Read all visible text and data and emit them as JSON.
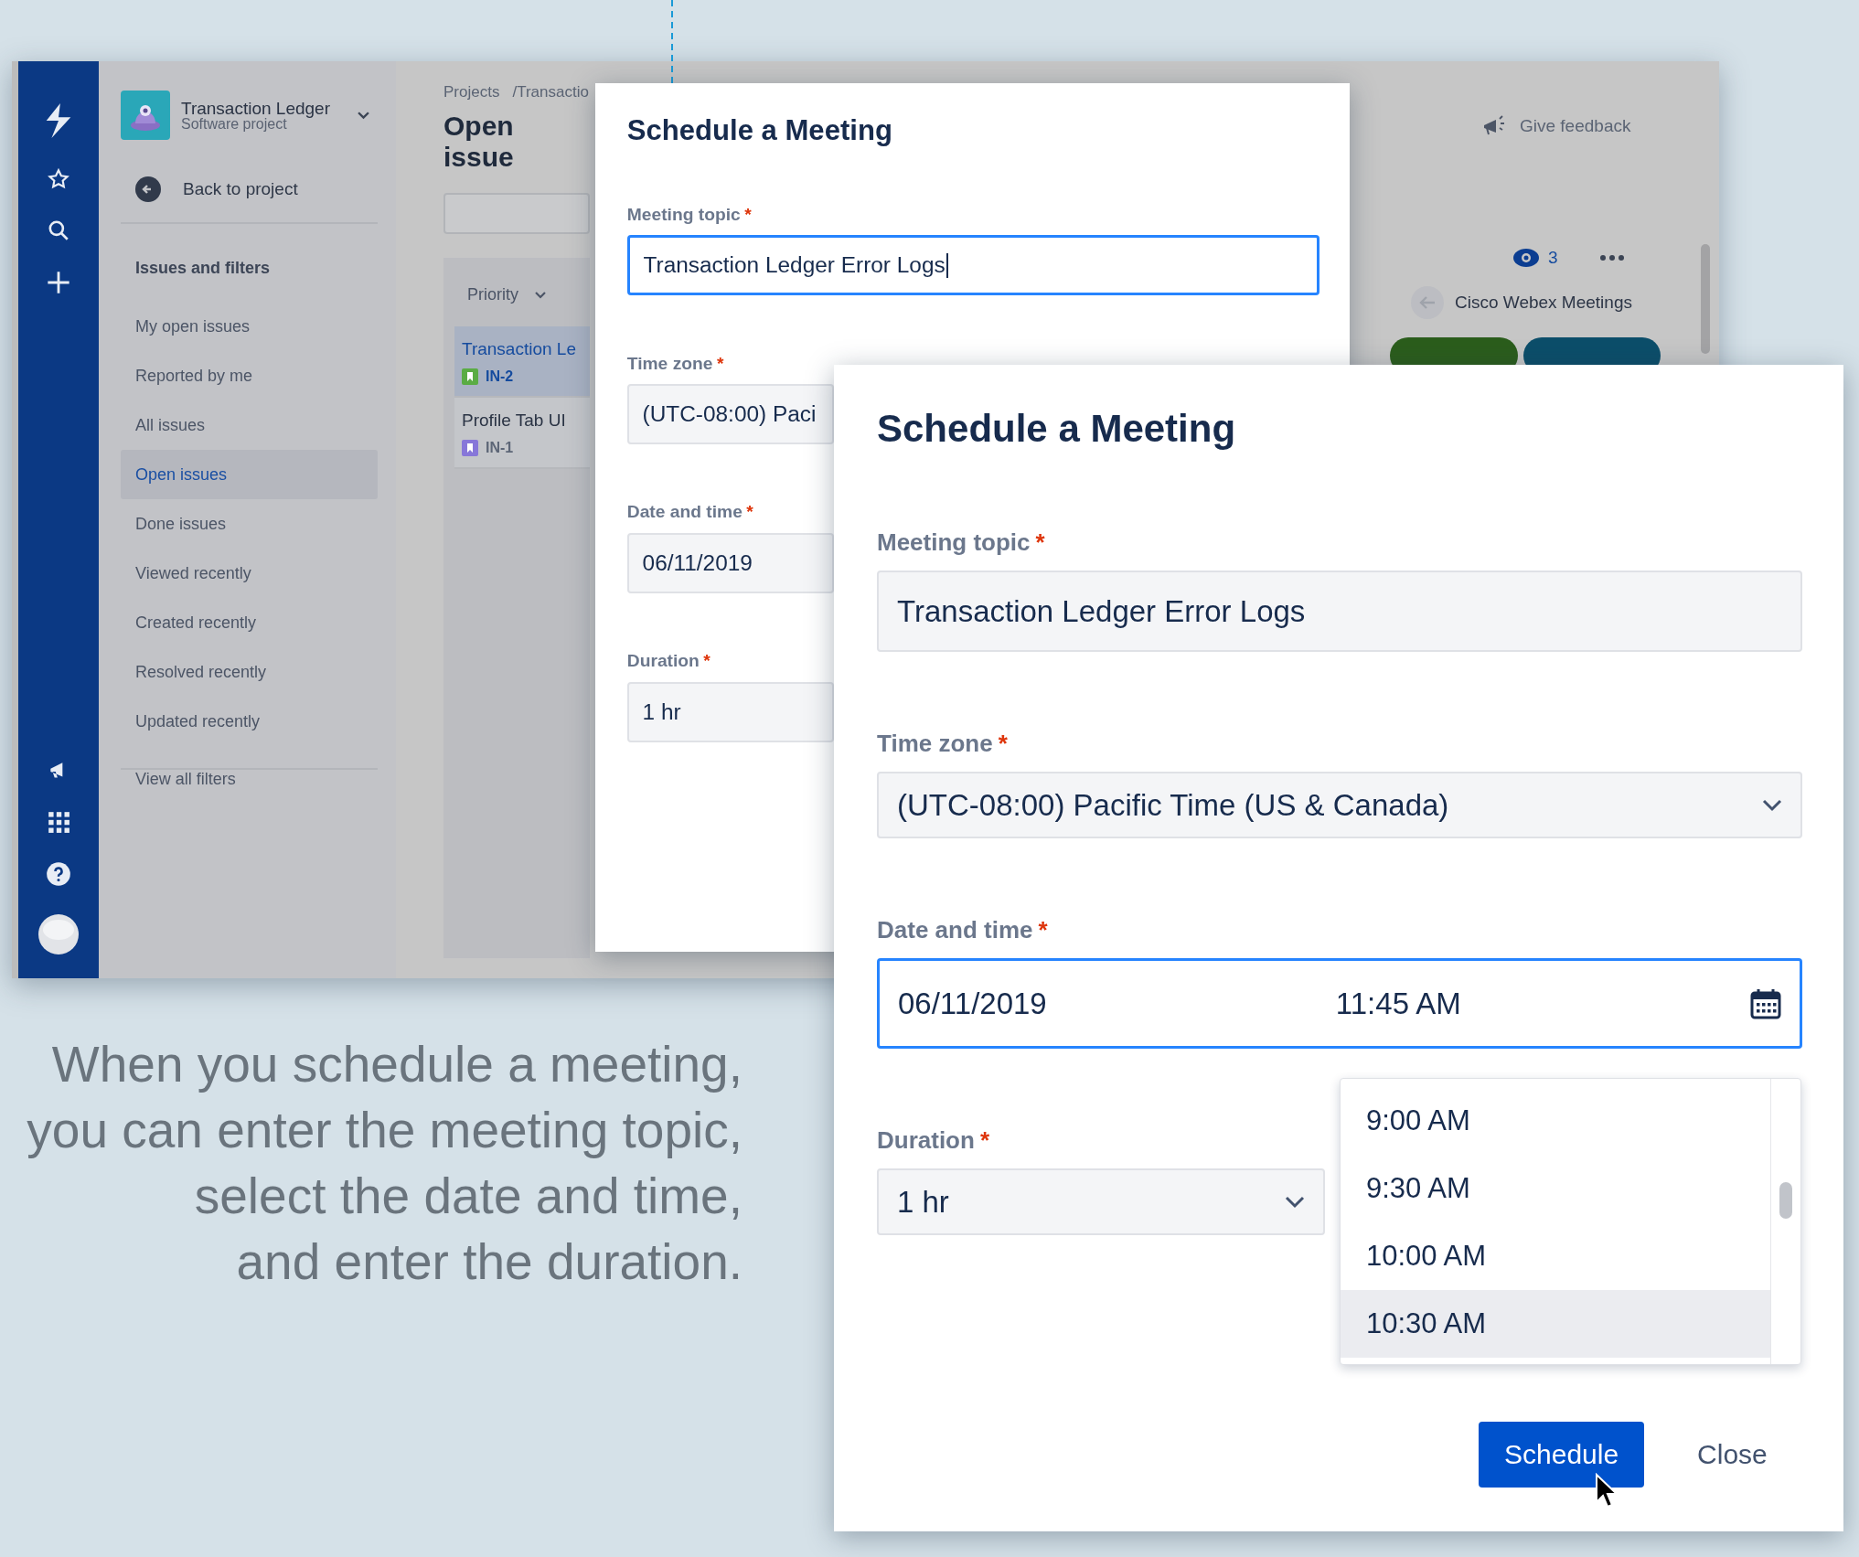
{
  "app_window": {
    "project": {
      "name": "Transaction Ledger",
      "type": "Software project"
    },
    "back_link": "Back to project",
    "sidebar": {
      "heading": "Issues and filters",
      "items": [
        {
          "label": "My open issues",
          "selected": false
        },
        {
          "label": "Reported by me",
          "selected": false
        },
        {
          "label": "All issues",
          "selected": false
        },
        {
          "label": "Open issues",
          "selected": true
        },
        {
          "label": "Done issues",
          "selected": false
        },
        {
          "label": "Viewed recently",
          "selected": false
        },
        {
          "label": "Created recently",
          "selected": false
        },
        {
          "label": "Resolved recently",
          "selected": false
        },
        {
          "label": "Updated recently",
          "selected": false
        }
      ],
      "footer_link": "View all filters"
    },
    "breadcrumb": [
      "Projects",
      "/Transactio"
    ],
    "page_title": "Open issue",
    "sort_label": "Priority",
    "issues": [
      {
        "title": "Transaction Le",
        "key": "IN-2",
        "color": "#5aac44",
        "selected": true
      },
      {
        "title": "Profile Tab UI",
        "key": "IN-1",
        "color": "#8777d9",
        "selected": false
      }
    ],
    "feedback": "Give feedback",
    "watchers": "3",
    "panel_title": "Cisco Webex Meetings"
  },
  "dialog_back": {
    "title": "Schedule a Meeting",
    "fields": [
      {
        "label": "Meeting topic",
        "required_mark": "*",
        "kind": "text",
        "value": "Transaction Ledger Error Logs",
        "focused": true
      },
      {
        "label": "Time zone",
        "required_mark": "*",
        "kind": "text",
        "value": "(UTC-08:00) Paci",
        "focused": false
      },
      {
        "label": "Date and time",
        "required_mark": "*",
        "kind": "text",
        "value": "06/11/2019",
        "focused": false
      },
      {
        "label": "Duration",
        "required_mark": "*",
        "kind": "text",
        "value": "1 hr",
        "focused": false
      }
    ]
  },
  "dialog_front": {
    "title": "Schedule a Meeting",
    "fields": [
      {
        "label": "Meeting topic",
        "required_mark": "*",
        "kind": "text",
        "value": "Transaction Ledger Error Logs",
        "focused": false
      },
      {
        "label": "Time zone",
        "required_mark": "*",
        "kind": "select",
        "value": "(UTC-08:00) Pacific Time (US & Canada)",
        "focused": false
      },
      {
        "label": "Date and time",
        "required_mark": "*",
        "kind": "datetime",
        "value": "06/11/2019",
        "time": "11:45 AM",
        "focused": true
      },
      {
        "label": "Duration",
        "required_mark": "*",
        "kind": "select",
        "value": "1 hr",
        "focused": false
      }
    ],
    "time_options": [
      {
        "label": "9:00 AM",
        "selected": false
      },
      {
        "label": "9:30 AM",
        "selected": false
      },
      {
        "label": "10:00 AM",
        "selected": false
      },
      {
        "label": "10:30 AM",
        "selected": true
      }
    ],
    "buttons": [
      {
        "label": "Schedule",
        "kind": "primary"
      },
      {
        "label": "Close",
        "kind": "subtle"
      }
    ]
  },
  "caption": [
    "When you schedule a meeting,",
    "you can enter the meeting topic,",
    "select the date and time,",
    "and enter the duration."
  ]
}
